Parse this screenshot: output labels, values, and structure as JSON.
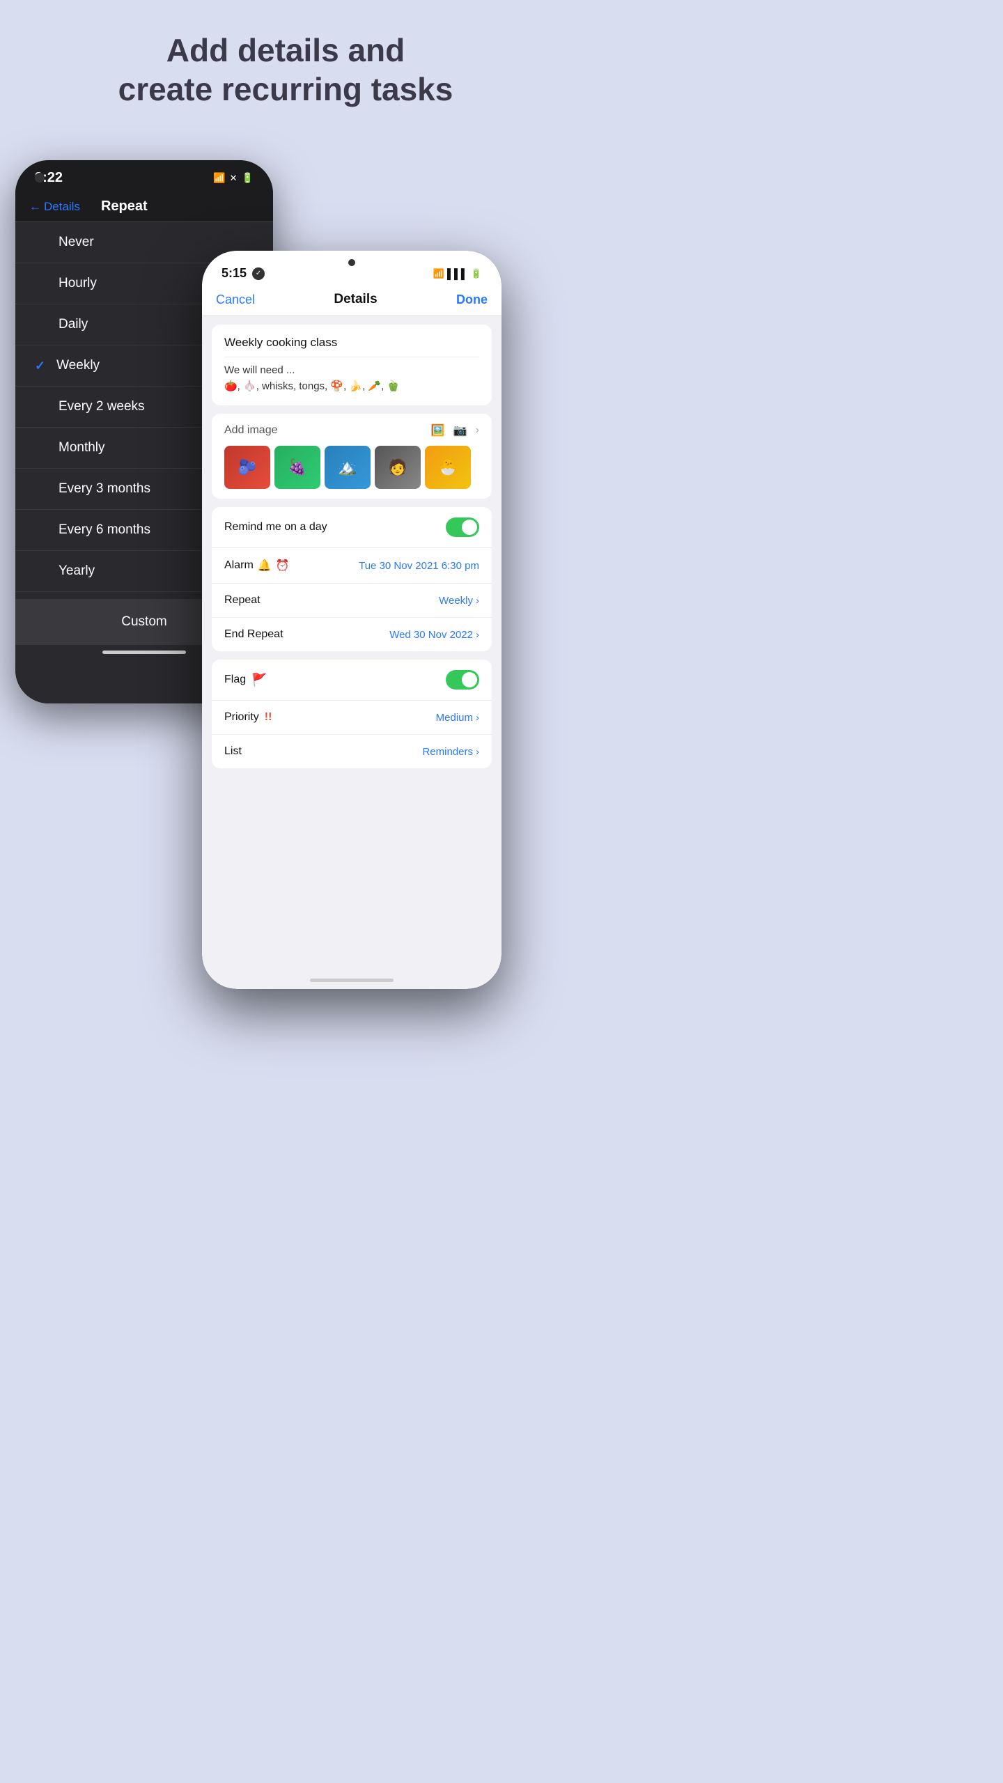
{
  "page": {
    "background_color": "#d8ddf0",
    "header": "Add details and\ncreate recurring tasks"
  },
  "back_phone": {
    "time": "9:22",
    "nav": {
      "back_label": "Details",
      "title": "Repeat"
    },
    "repeat_options": [
      {
        "label": "Never",
        "selected": false
      },
      {
        "label": "Hourly",
        "selected": false
      },
      {
        "label": "Daily",
        "selected": false
      },
      {
        "label": "Weekly",
        "selected": true
      },
      {
        "label": "Every 2 weeks",
        "selected": false
      },
      {
        "label": "Monthly",
        "selected": false
      },
      {
        "label": "Every 3 months",
        "selected": false
      },
      {
        "label": "Every 6 months",
        "selected": false
      },
      {
        "label": "Yearly",
        "selected": false
      }
    ],
    "custom_label": "Custom"
  },
  "front_phone": {
    "time": "5:15",
    "nav": {
      "cancel_label": "Cancel",
      "title": "Details",
      "done_label": "Done"
    },
    "task": {
      "title": "Weekly cooking class",
      "description": "We will need ...\n🍅, 🧄, whisks, tongs, 🍄, 🍌, 🥕, 🫑"
    },
    "add_image_label": "Add image",
    "remind_label": "Remind me on a day",
    "remind_enabled": true,
    "alarm_label": "Alarm",
    "alarm_value": "Tue 30 Nov 2021 6:30 pm",
    "repeat_label": "Repeat",
    "repeat_value": "Weekly",
    "end_repeat_label": "End Repeat",
    "end_repeat_value": "Wed 30 Nov 2022",
    "flag_label": "Flag",
    "flag_enabled": true,
    "priority_label": "Priority",
    "priority_value": "Medium",
    "list_label": "List",
    "list_value": "Reminders"
  }
}
